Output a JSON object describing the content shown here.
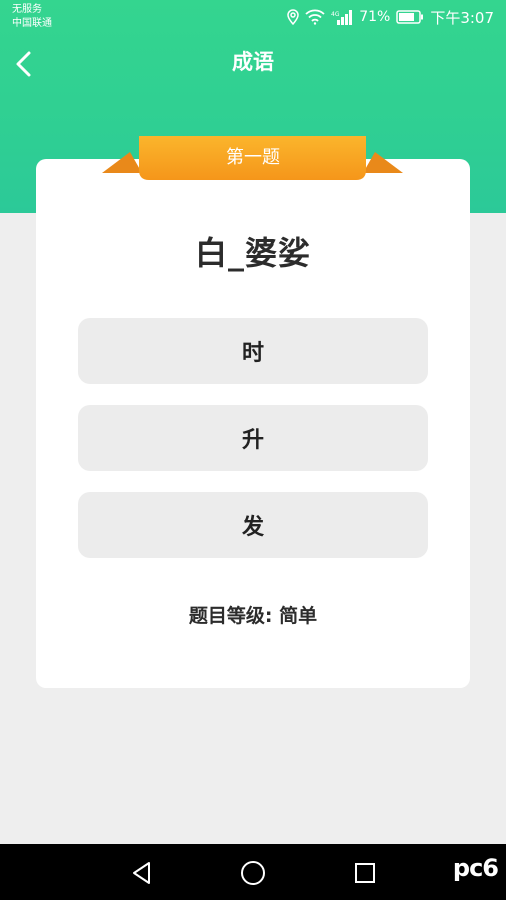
{
  "status_bar": {
    "carrier_line1": "无服务",
    "carrier_line2": "中国联通",
    "battery": "71%",
    "time": "下午3:07",
    "icons": [
      "location-icon",
      "wifi-icon",
      "signal-icon",
      "battery-icon"
    ]
  },
  "header": {
    "title": "成语",
    "back_icon": "chevron-left-icon"
  },
  "card": {
    "ribbon_label": "第一题",
    "question": "白_婆娑",
    "options": [
      "时",
      "升",
      "发"
    ],
    "level_text": "题目等级: 简单"
  },
  "nav_bar": {
    "buttons": [
      "back-triangle-icon",
      "home-circle-icon",
      "recent-square-icon"
    ],
    "watermark": "pc6"
  },
  "colors": {
    "header_green": "#2fcf93",
    "ribbon_orange": "#f7a21e",
    "option_bg": "#ececec",
    "page_bg": "#eeeeee"
  }
}
